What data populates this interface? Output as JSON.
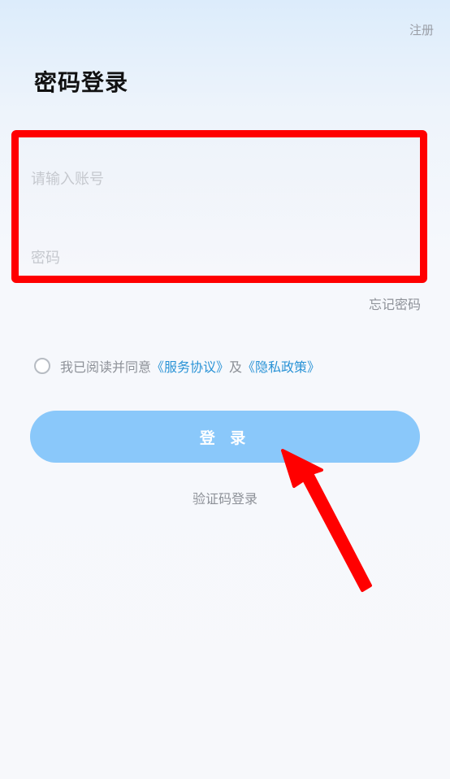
{
  "header": {
    "register_label": "注册"
  },
  "title": "密码登录",
  "form": {
    "account_placeholder": "请输入账号",
    "password_placeholder": "密码",
    "forgot_label": "忘记密码"
  },
  "agreement": {
    "prefix": "我已阅读并同意",
    "service_link": "《服务协议》",
    "joiner": "及",
    "privacy_link": "《隐私政策》"
  },
  "login_button": "登 录",
  "sms_login": "验证码登录",
  "colors": {
    "accent_blue": "#2a93d6",
    "button_blue": "#8ac8fa",
    "annotation_red": "#ff0000"
  }
}
